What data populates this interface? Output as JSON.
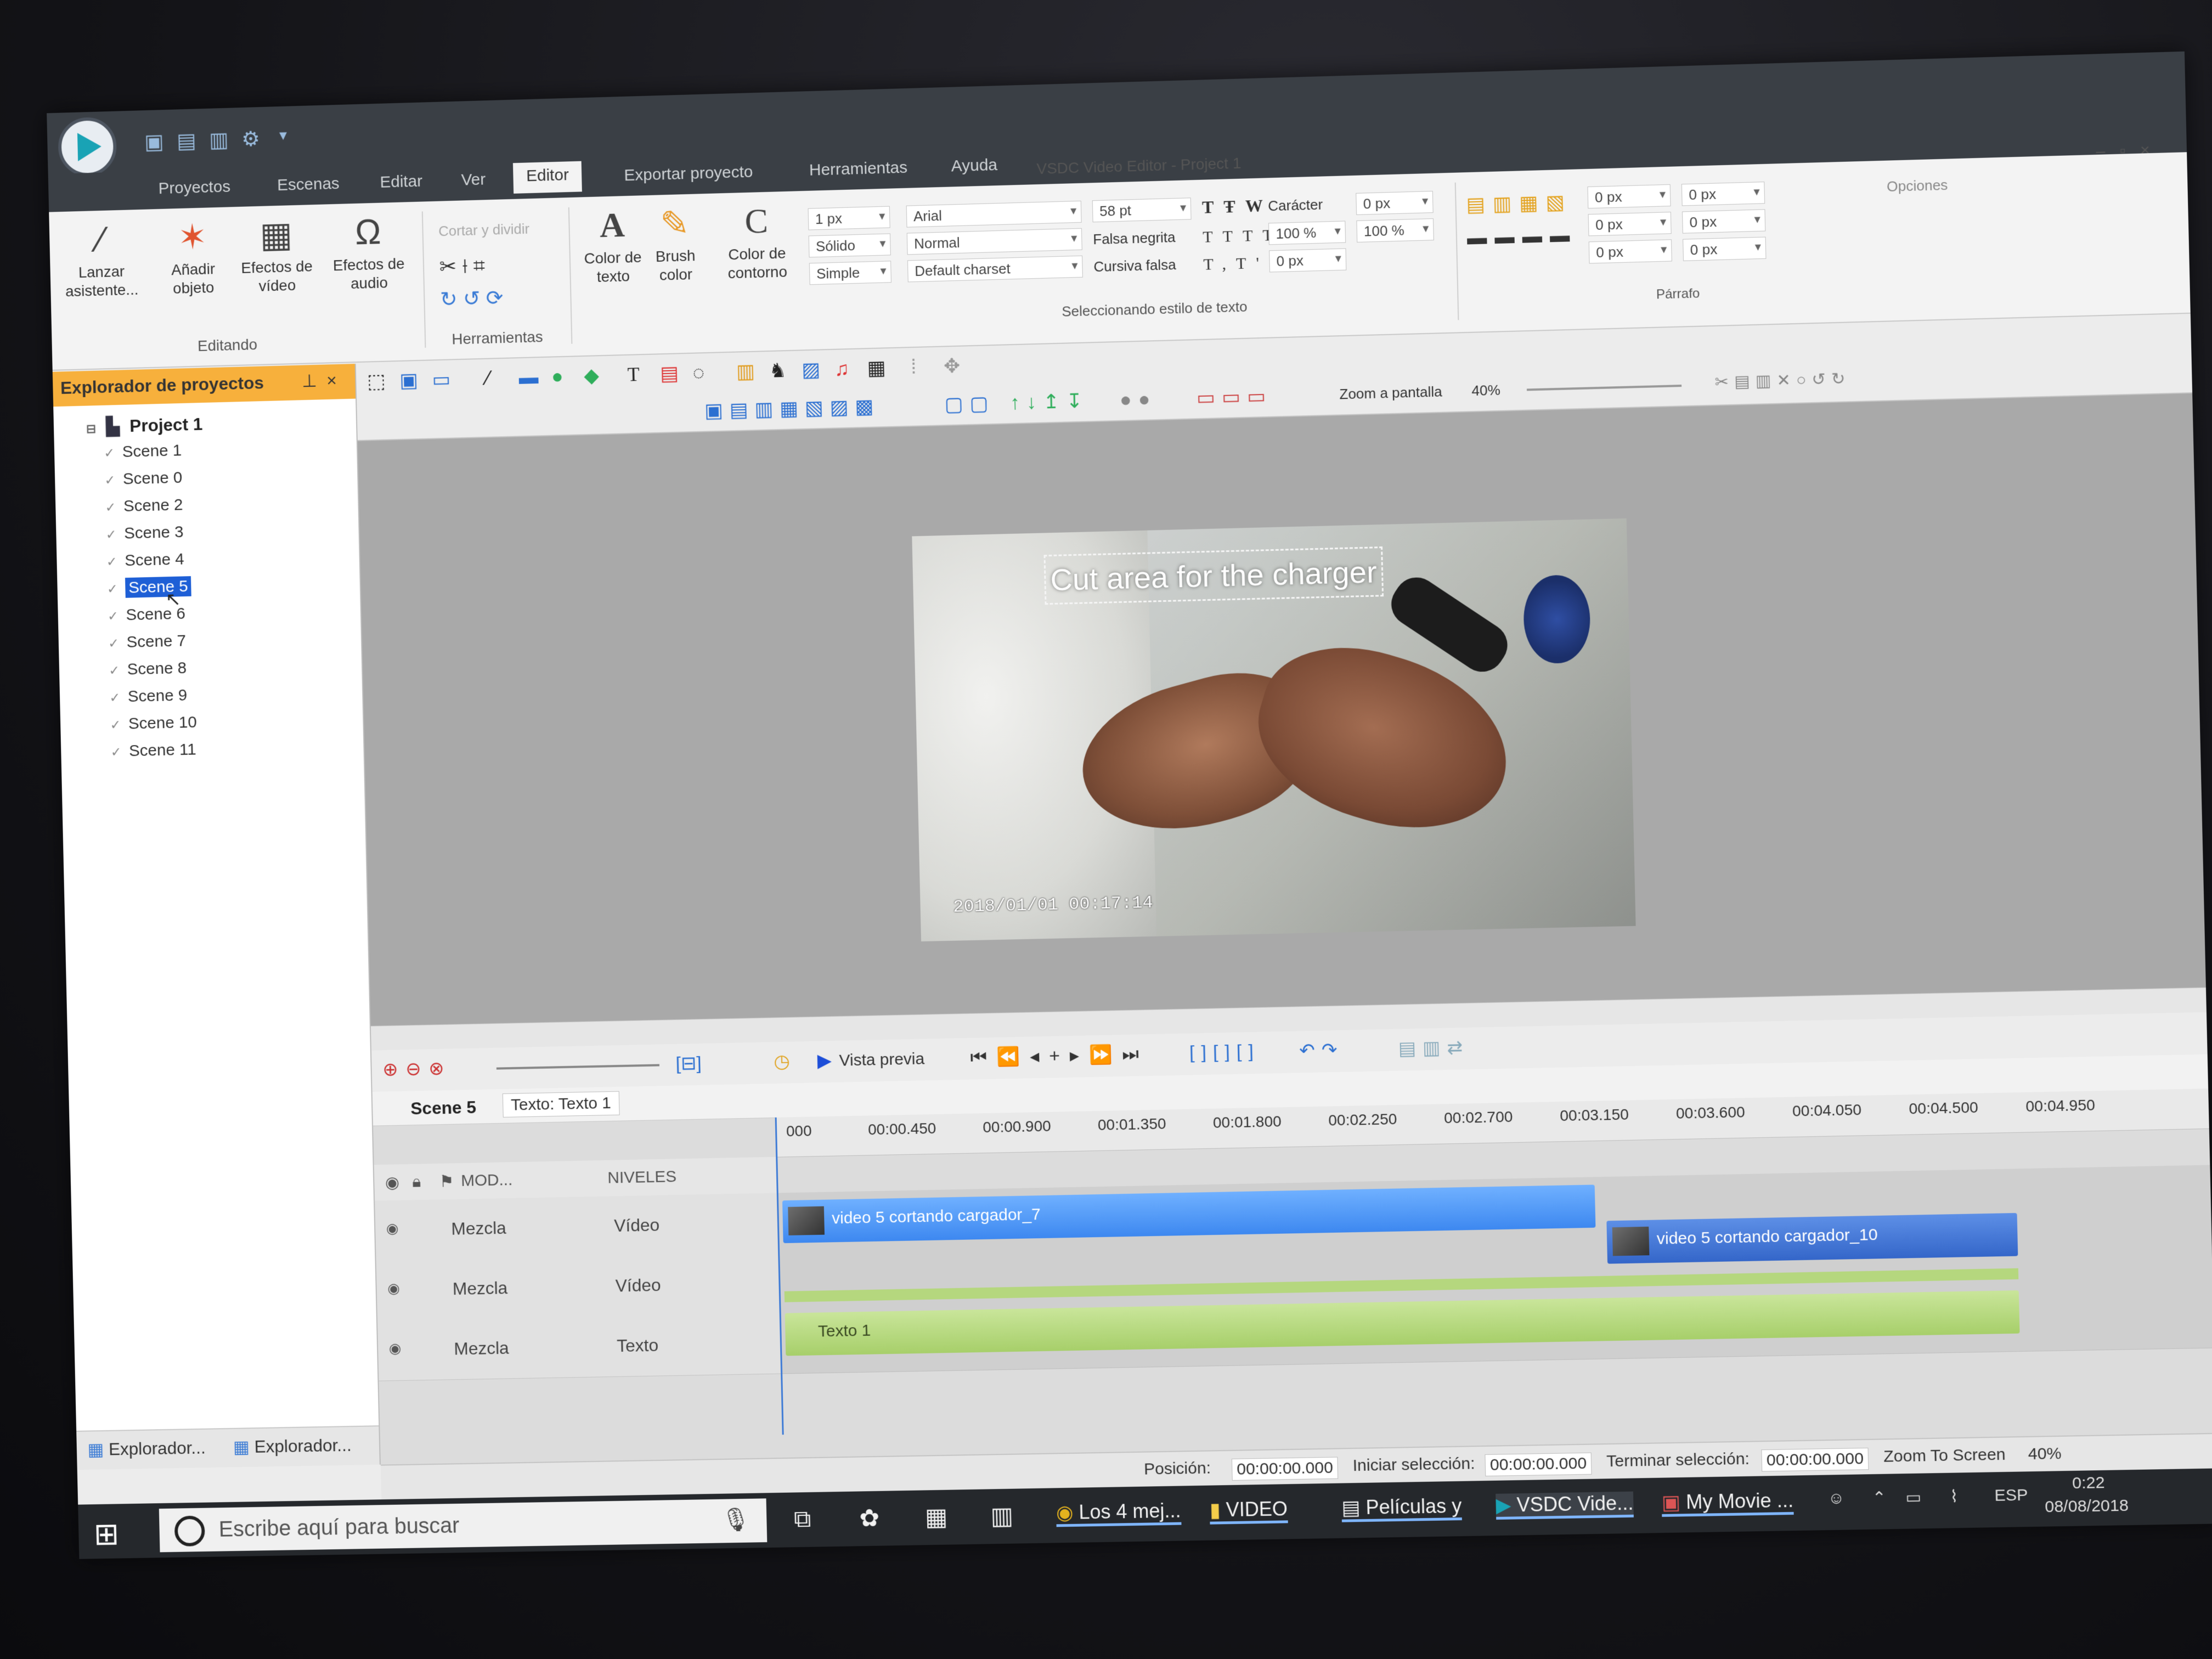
{
  "window": {
    "title": "VSDC Video Editor - Project 1"
  },
  "menu_tabs": [
    "Proyectos",
    "Escenas",
    "Editar",
    "Ver",
    "Editor",
    "Exportar proyecto",
    "Herramientas",
    "Ayuda"
  ],
  "ribbon": {
    "wizard": "Lanzar asistente...",
    "add_object": "Añadir objeto",
    "video_effects": "Efectos de vídeo",
    "audio_effects": "Efectos de audio",
    "group_editing": "Editando",
    "cut_split": "Cortar y dividir",
    "group_tools": "Herramientas",
    "text_color": "Color de texto",
    "brush_color": "Brush color",
    "outline_color": "Color de contorno",
    "line_width": "1 px",
    "line_style": "Sólido",
    "line_type": "Simple",
    "font": "Arial",
    "font_style": "Normal",
    "charset": "Default charset",
    "font_size": "58 pt",
    "fake_bold": "Falsa negrita",
    "fake_italic": "Cursiva falsa",
    "caracter": "Carácter",
    "px0": "0 px",
    "pct100": "100 %",
    "group_text_style": "Seleccionando estilo de texto",
    "group_parrafo": "Párrafo",
    "options": "Opciones"
  },
  "explorer": {
    "title": "Explorador de proyectos",
    "project": "Project 1",
    "scenes": [
      "Scene 1",
      "Scene 0",
      "Scene 2",
      "Scene 3",
      "Scene 4",
      "Scene 5",
      "Scene 6",
      "Scene 7",
      "Scene 8",
      "Scene 9",
      "Scene 10",
      "Scene 11"
    ],
    "selected": "Scene 5",
    "footer_tabs": [
      "Explorador...",
      "Explorador..."
    ]
  },
  "canvas": {
    "zoom_label": "Zoom a pantalla",
    "zoom_value": "40%",
    "caption": "Cut area for the charger",
    "timestamp": "2018/01/01  00:17:14"
  },
  "timeline": {
    "preview_label": "Vista previa",
    "scene_tab": "Scene 5",
    "object_tab": "Texto: Texto 1",
    "ruler": [
      "000",
      "00:00.450",
      "00:00.900",
      "00:01.350",
      "00:01.800",
      "00:02.250",
      "00:02.700",
      "00:03.150",
      "00:03.600",
      "00:04.050",
      "00:04.500",
      "00:04.950"
    ],
    "col_mode": "MOD...",
    "col_levels": "NIVELES",
    "tracks": [
      {
        "blend": "Mezcla",
        "kind": "Vídeo"
      },
      {
        "blend": "Mezcla",
        "kind": "Vídeo"
      },
      {
        "blend": "Mezcla",
        "kind": "Texto"
      }
    ],
    "clips": {
      "clip1": "video 5 cortando cargador_7",
      "clip2": "video 5 cortando cargador_10",
      "clip3": "Texto 1"
    }
  },
  "status": {
    "position_label": "Posición:",
    "position_value": "00:00:00.000",
    "start_sel_label": "Iniciar selección:",
    "start_sel_value": "00:00:00.000",
    "end_sel_label": "Terminar selección:",
    "end_sel_value": "00:00:00.000",
    "zoom_label": "Zoom To Screen",
    "zoom_value": "40%"
  },
  "taskbar": {
    "search_placeholder": "Escribe aquí para buscar",
    "items": [
      "Los 4 mej...",
      "VIDEO",
      "Películas y",
      "VSDC Vide...",
      "My Movie ..."
    ],
    "lang": "ESP",
    "time": "0:22",
    "date": "08/08/2018"
  },
  "colors": {
    "explorer_header": "#f7b03c",
    "selection": "#1e5fd6",
    "video_clip": "#4a90f0",
    "text_clip": "#b5d77e"
  }
}
